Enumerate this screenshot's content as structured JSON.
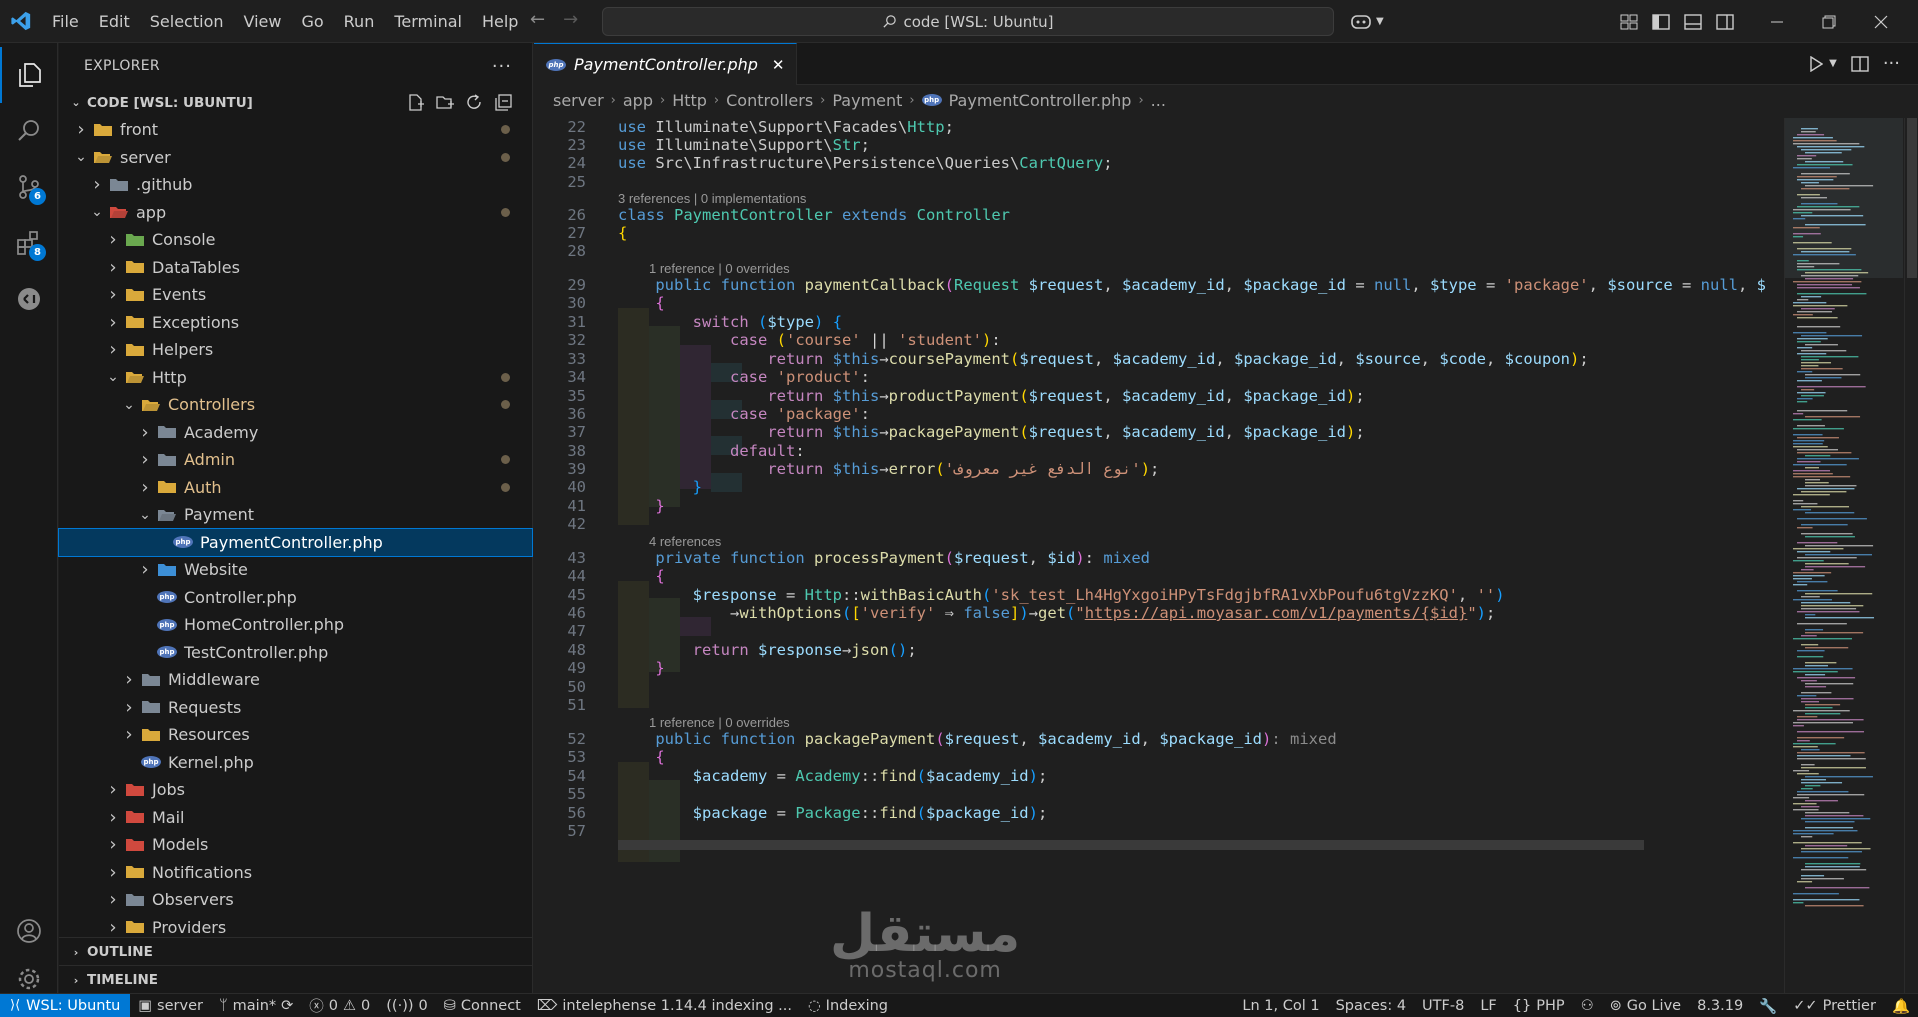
{
  "menu": [
    "File",
    "Edit",
    "Selection",
    "View",
    "Go",
    "Run",
    "Terminal",
    "Help"
  ],
  "command_center": "code [WSL: Ubuntu]",
  "activity": {
    "scm_badge": "6",
    "extensions_badge": "8"
  },
  "explorer": {
    "title": "EXPLORER",
    "root": "CODE [WSL: UBUNTU]",
    "tree": [
      {
        "label": "front",
        "depth": 0,
        "open": false,
        "kind": "folder",
        "dot": true
      },
      {
        "label": "server",
        "depth": 0,
        "open": true,
        "kind": "folder-open",
        "dot": true
      },
      {
        "label": ".github",
        "depth": 1,
        "open": false,
        "kind": "folder-dark"
      },
      {
        "label": "app",
        "depth": 1,
        "open": true,
        "kind": "folder-red",
        "dot": true
      },
      {
        "label": "Console",
        "depth": 2,
        "open": false,
        "kind": "folder-green"
      },
      {
        "label": "DataTables",
        "depth": 2,
        "open": false,
        "kind": "folder"
      },
      {
        "label": "Events",
        "depth": 2,
        "open": false,
        "kind": "folder"
      },
      {
        "label": "Exceptions",
        "depth": 2,
        "open": false,
        "kind": "folder"
      },
      {
        "label": "Helpers",
        "depth": 2,
        "open": false,
        "kind": "folder"
      },
      {
        "label": "Http",
        "depth": 2,
        "open": true,
        "kind": "folder-open",
        "dot": true
      },
      {
        "label": "Controllers",
        "depth": 3,
        "open": true,
        "kind": "folder-open",
        "dot": true,
        "labelColor": "#e2c08d"
      },
      {
        "label": "Academy",
        "depth": 4,
        "open": false,
        "kind": "folder-dark"
      },
      {
        "label": "Admin",
        "depth": 4,
        "open": false,
        "kind": "folder-dark",
        "dot": true,
        "labelColor": "#e2c08d"
      },
      {
        "label": "Auth",
        "depth": 4,
        "open": false,
        "kind": "folder",
        "dot": true,
        "labelColor": "#e2c08d"
      },
      {
        "label": "Payment",
        "depth": 4,
        "open": true,
        "kind": "folder-dark-open"
      },
      {
        "label": "PaymentController.php",
        "depth": 5,
        "kind": "php",
        "selected": true
      },
      {
        "label": "Website",
        "depth": 4,
        "open": false,
        "kind": "folder-blue"
      },
      {
        "label": "Controller.php",
        "depth": 4,
        "kind": "php"
      },
      {
        "label": "HomeController.php",
        "depth": 4,
        "kind": "php"
      },
      {
        "label": "TestController.php",
        "depth": 4,
        "kind": "php"
      },
      {
        "label": "Middleware",
        "depth": 3,
        "open": false,
        "kind": "folder-dark"
      },
      {
        "label": "Requests",
        "depth": 3,
        "open": false,
        "kind": "folder-dark"
      },
      {
        "label": "Resources",
        "depth": 3,
        "open": false,
        "kind": "folder"
      },
      {
        "label": "Kernel.php",
        "depth": 3,
        "kind": "php"
      },
      {
        "label": "Jobs",
        "depth": 2,
        "open": false,
        "kind": "folder-red"
      },
      {
        "label": "Mail",
        "depth": 2,
        "open": false,
        "kind": "folder-red"
      },
      {
        "label": "Models",
        "depth": 2,
        "open": false,
        "kind": "folder-red"
      },
      {
        "label": "Notifications",
        "depth": 2,
        "open": false,
        "kind": "folder"
      },
      {
        "label": "Observers",
        "depth": 2,
        "open": false,
        "kind": "folder-dark"
      },
      {
        "label": "Providers",
        "depth": 2,
        "open": false,
        "kind": "folder"
      }
    ],
    "outline": "OUTLINE",
    "timeline": "TIMELINE"
  },
  "editor": {
    "tab": "PaymentController.php",
    "breadcrumb": [
      "server",
      "app",
      "Http",
      "Controllers",
      "Payment",
      "PaymentController.php",
      "..."
    ]
  },
  "code": {
    "lens_class": "3 references | 0 implementations",
    "lens_callback": "1 reference | 0 overrides",
    "lens_process": "4 references",
    "lens_package": "1 reference | 0 overrides",
    "url": "https://api.moyasar.com/v1/payments/{$id}",
    "api_key": "'sk_test_Lh4HgYxgoiHPyTsFdgjbfRA1vXbPoufu6tgVzzKQ'",
    "arabic_error": "'نوع الدفع غير معروف'"
  },
  "status": {
    "remote": "WSL: Ubuntu",
    "folder": "server",
    "branch": "main*",
    "errors": "0",
    "warnings": "0",
    "ports": "0",
    "connect": "Connect",
    "intelephense": "intelephense 1.14.4 indexing ...",
    "indexing": "Indexing",
    "cursor": "Ln 1, Col 1",
    "spaces": "Spaces: 4",
    "encoding": "UTF-8",
    "eol": "LF",
    "language": "PHP",
    "golive": "Go Live",
    "php_version": "8.3.19",
    "prettier": "Prettier"
  },
  "watermark": {
    "arabic": "مستقل",
    "latin": "mostaql.com"
  }
}
